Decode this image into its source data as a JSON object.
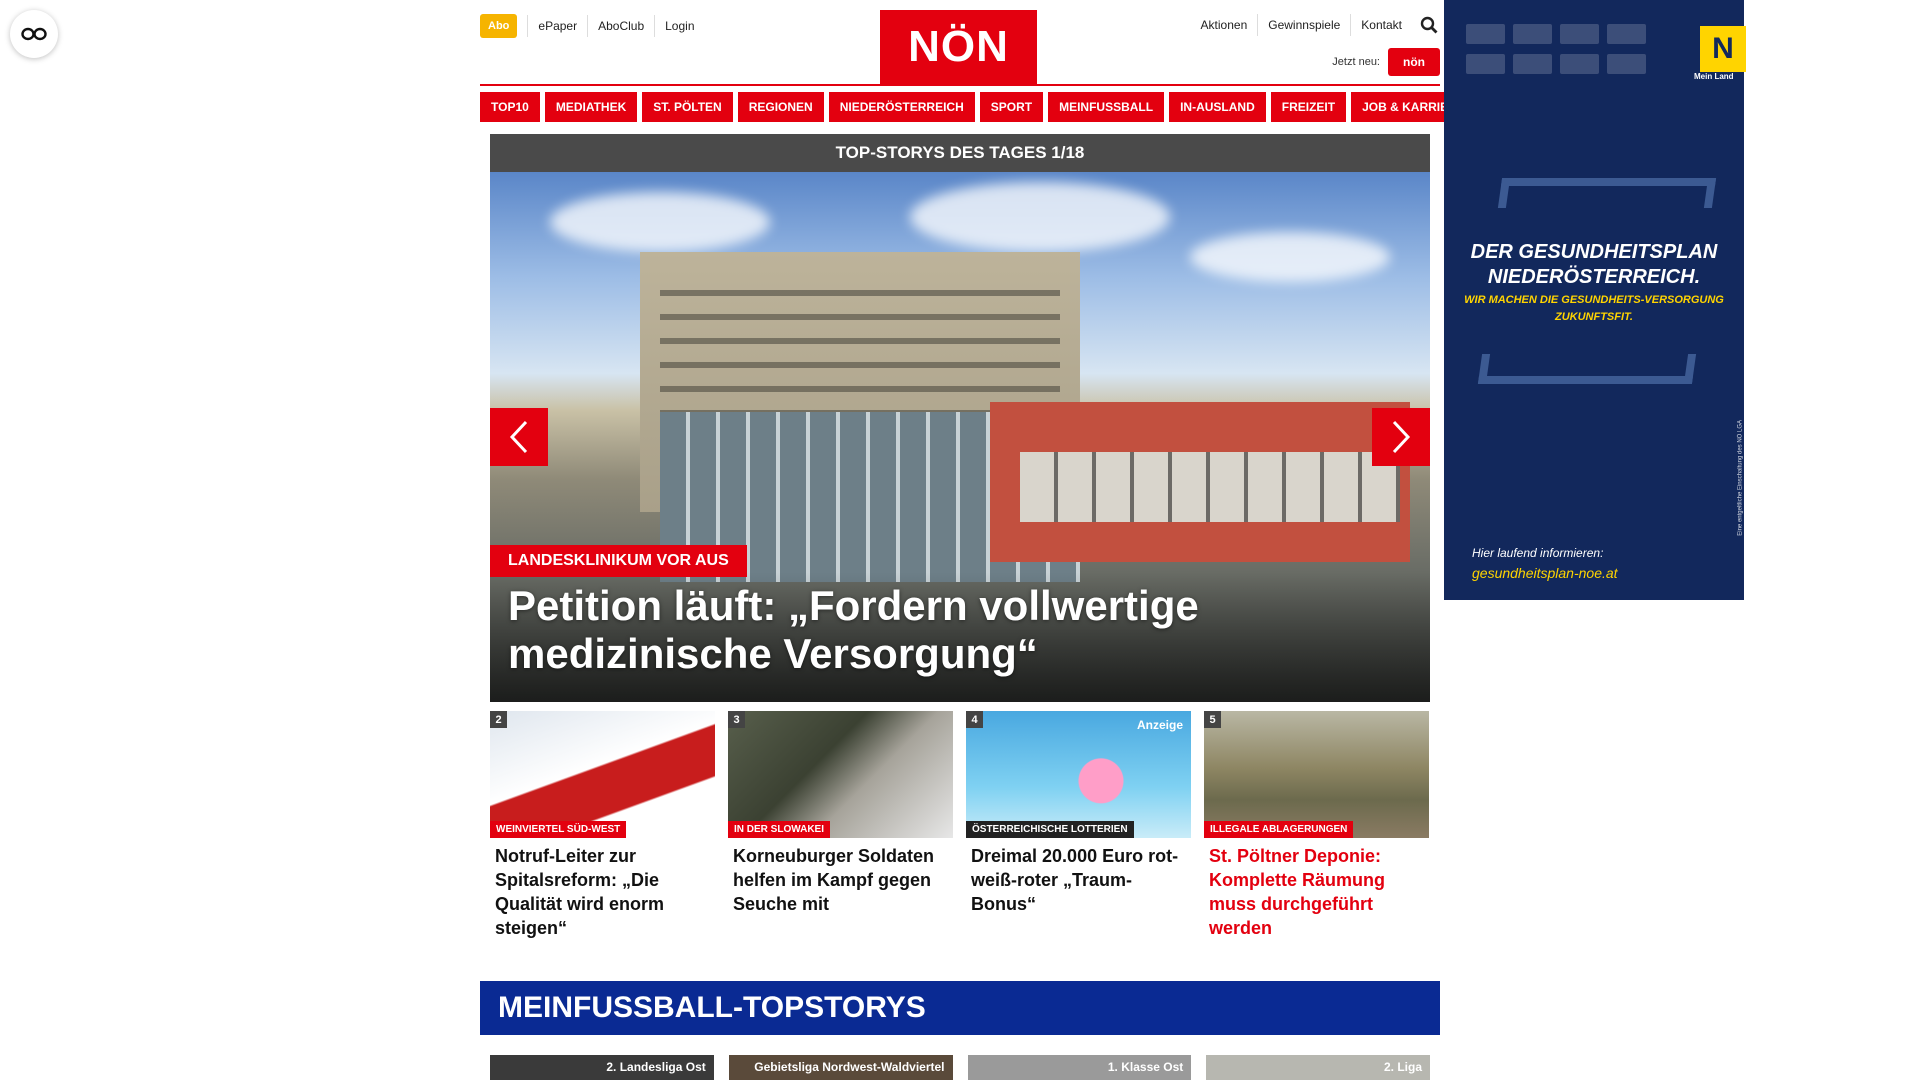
{
  "header": {
    "abo": "Abo",
    "left_links": [
      "ePaper",
      "AboClub",
      "Login"
    ],
    "logo": "NÖN",
    "right_links": [
      "Aktionen",
      "Gewinnspiele",
      "Kontakt"
    ],
    "jetzt_neu": "Jetzt neu:",
    "jetzt_badge": "nön"
  },
  "nav": [
    "TOP10",
    "MEDIATHEK",
    "ST. PÖLTEN",
    "REGIONEN",
    "NIEDERÖSTERREICH",
    "SPORT",
    "MEINFUSSBALL",
    "IN-AUSLAND",
    "FREIZEIT",
    "JOB & KARRIERE"
  ],
  "hero": {
    "heading": "TOP-STORYS DES TAGES 1/18",
    "kicker": "LANDESKLINIKUM VOR AUS",
    "title": "Petition läuft: „Fordern vollwertige medizinische Versorgung“"
  },
  "teasers": [
    {
      "num": "2",
      "category": "WEINVIERTEL SÜD-WEST",
      "title": "Notruf-Leiter zur Spitalsreform: „Die Qualität wird enorm steigen“"
    },
    {
      "num": "3",
      "category": "IN DER SLOWAKEI",
      "title": "Korneuburger Soldaten helfen im Kampf gegen Seuche mit"
    },
    {
      "num": "4",
      "category": "ÖSTERREICHISCHE LOTTERIEN",
      "anzeige": "Anzeige",
      "title": "Dreimal 20.000 Euro rot-weiß-roter „Traum-Bonus“"
    },
    {
      "num": "5",
      "category": "ILLEGALE ABLAGERUNGEN",
      "title": "St. Pöltner Deponie: Komplette Räumung muss durchgeführt werden"
    }
  ],
  "section": {
    "title": "MEINFUSSBALL-TOPSTORYS",
    "items": [
      "2. Landesliga Ost",
      "Gebietsliga Nordwest-Waldviertel",
      "1. Klasse Ost",
      "2. Liga"
    ]
  },
  "ad": {
    "mein_land": "Mein Land",
    "headline": "DER GESUNDHEITSPLAN NIEDERÖSTERREICH.",
    "sub": "WIR MACHEN DIE GESUNDHEITS-VERSORGUNG ZUKUNFTSFIT.",
    "info": "Hier laufend informieren:",
    "url": "gesundheitsplan-noe.at",
    "vertical": "Eine entgeltliche Einschaltung des NÖ LGA"
  },
  "colors": {
    "brand_red": "#e3000f",
    "abo_yellow": "#f6b400",
    "section_blue": "#0a2a93",
    "ad_navy": "#12285c"
  }
}
